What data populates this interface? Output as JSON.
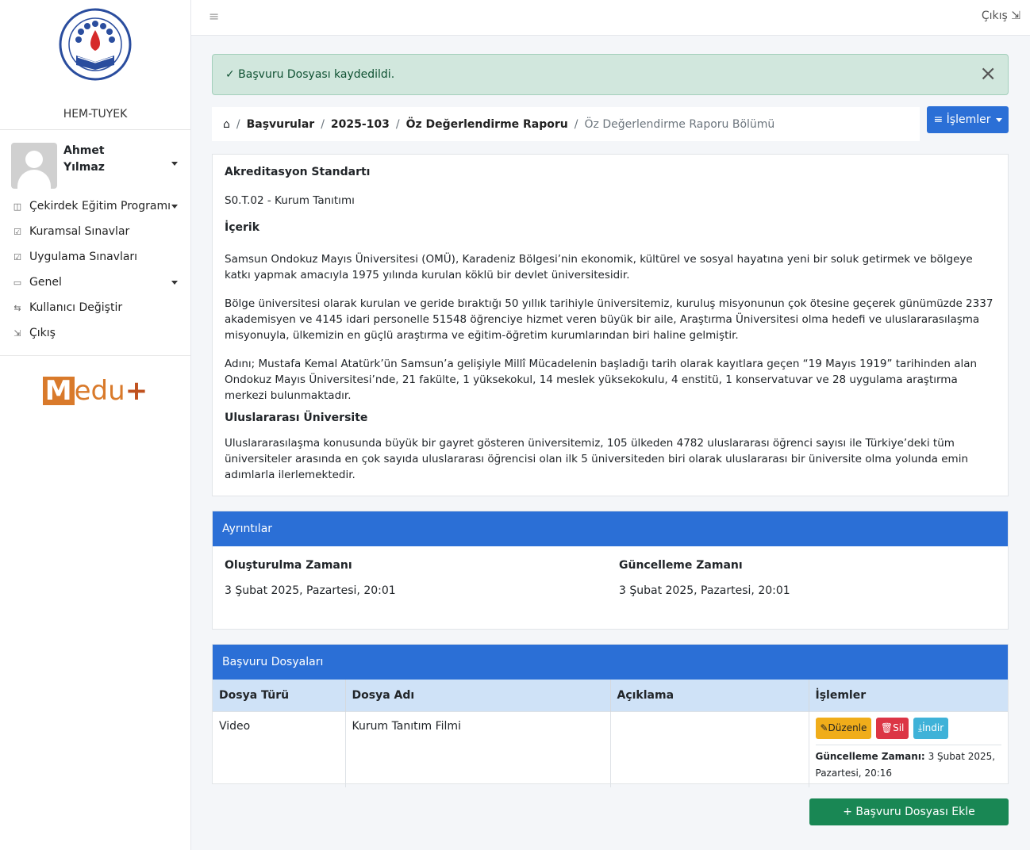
{
  "sidebar": {
    "brand": "HEM-TUYEK",
    "user": {
      "first": "Ahmet",
      "last": "Yılmaz"
    },
    "items": [
      {
        "icon": "book-icon",
        "glyph": "◫",
        "label": "Çekirdek Eğitim Programı",
        "dropdown": true
      },
      {
        "icon": "edit-icon",
        "glyph": "☑",
        "label": "Kuramsal Sınavlar",
        "dropdown": false
      },
      {
        "icon": "edit-icon",
        "glyph": "☑",
        "label": "Uygulama Sınavları",
        "dropdown": false
      },
      {
        "icon": "folder-icon",
        "glyph": "▭",
        "label": "Genel",
        "dropdown": true
      },
      {
        "icon": "switch-icon",
        "glyph": "⇆",
        "label": "Kullanıcı Değiştir",
        "dropdown": false
      },
      {
        "icon": "signpost-icon",
        "glyph": "⇲",
        "label": "Çıkış",
        "dropdown": false
      }
    ],
    "medu_logo": {
      "m": "M",
      "rest": "edu",
      "plus": "+"
    }
  },
  "topbar": {
    "logout": "Çıkış ⇲"
  },
  "alert": {
    "text": "✓ Başvuru Dosyası kaydedildi.",
    "close": "×"
  },
  "breadcrumb": {
    "home_icon": "⌂",
    "items": [
      "Başvurular",
      "2025-103",
      "Öz Değerlendirme Raporu"
    ],
    "current": "Öz Değerlendirme Raporu Bölümü"
  },
  "actions_button": "≡ İşlemler",
  "main": {
    "standard_title": "Akreditasyon Standartı",
    "standard_value": "S0.T.02 - Kurum Tanıtımı",
    "content_title": "İçerik",
    "paragraphs": [
      "Samsun Ondokuz Mayıs Üniversitesi (OMÜ), Karadeniz Bölgesi’nin ekonomik, kültürel ve sosyal hayatına yeni bir soluk getirmek ve bölgeye katkı yapmak amacıyla 1975 yılında kurulan köklü bir devlet üniversitesidir.",
      "Bölge üniversitesi olarak kurulan ve geride bıraktığı 50 yıllık tarihiyle üniversitemiz, kuruluş misyonunun çok ötesine geçerek günümüzde 2337 akademisyen ve 4145 idari personelle 51548 öğrenciye hizmet veren büyük bir aile, Araştırma Üniversitesi olma hedefi ve uluslararasılaşma misyonuyla, ülkemizin en güçlü araştırma ve eğitim-öğretim kurumlarından biri haline gelmiştir.",
      "Adını; Mustafa Kemal Atatürk’ün Samsun’a gelişiyle Millî Mücadelenin başladığı tarih olarak kayıtlara geçen “19 Mayıs 1919” tarihinden alan Ondokuz Mayıs Üniversitesi’nde, 21 fakülte, 1 yüksekokul, 14 meslek yüksekokulu, 4 enstitü, 1 konservatuvar ve 28 uygulama araştırma merkezi bulunmaktadır."
    ],
    "intl_title": "Uluslararası Üniversite",
    "intl_paragraph": "Uluslararasılaşma konusunda büyük bir gayret gösteren üniversitemiz, 105 ülkeden 4782 uluslararası öğrenci sayısı ile Türkiye’deki tüm üniversiteler arasında en çok sayıda uluslararası öğrencisi olan ilk 5 üniversiteden biri olarak uluslararası bir üniversite olma yolunda emin adımlarla ilerlemektedir."
  },
  "details": {
    "header": "Ayrıntılar",
    "created_label": "Oluşturulma Zamanı",
    "created_value": "3 Şubat 2025, Pazartesi, 20:01",
    "updated_label": "Güncelleme Zamanı",
    "updated_value": "3 Şubat 2025, Pazartesi, 20:01"
  },
  "files": {
    "header": "Başvuru Dosyaları",
    "columns": [
      "Dosya Türü",
      "Dosya Adı",
      "Açıklama",
      "İşlemler"
    ],
    "rows": [
      {
        "type": "Video",
        "name": "Kurum Tanıtım Filmi",
        "description": "",
        "edit": "✎Düzenle",
        "delete": "🗑Sil",
        "download": "⤓İndir",
        "updated_label": "Güncelleme Zamanı:",
        "updated_value": "3 Şubat 2025, Pazartesi, 20:16"
      }
    ]
  },
  "add_button": "+ Başvuru Dosyası Ekle"
}
